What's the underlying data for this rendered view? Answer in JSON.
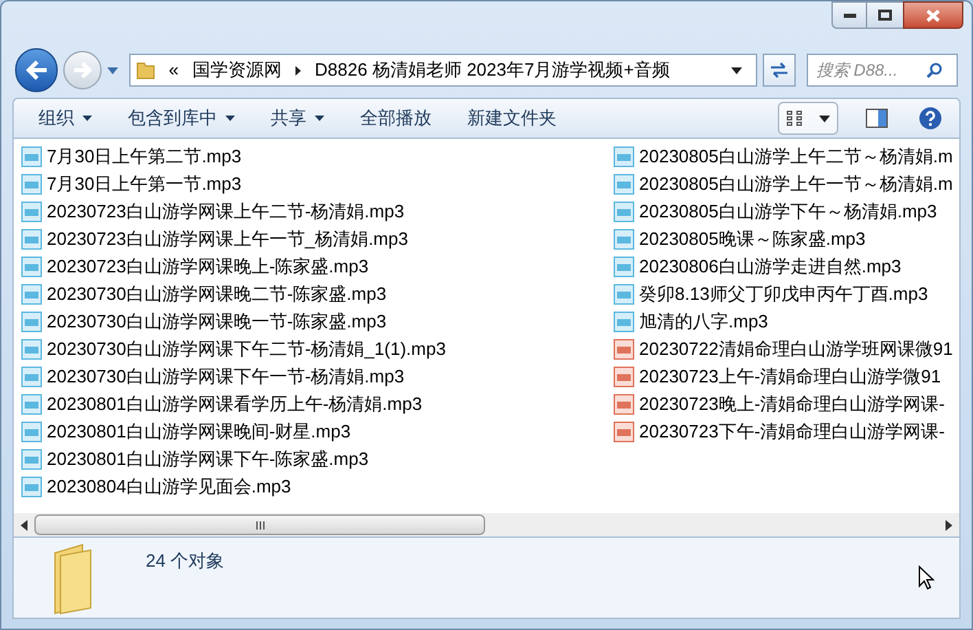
{
  "address_bar": {
    "overflow": "«",
    "path": [
      {
        "label": "国学资源网"
      },
      {
        "label": "D8826 杨清娟老师 2023年7月游学视频+音频"
      }
    ]
  },
  "search": {
    "placeholder": "搜索 D88..."
  },
  "toolbar": [
    {
      "label": "组织",
      "dropdown": true
    },
    {
      "label": "包含到库中",
      "dropdown": true
    },
    {
      "label": "共享",
      "dropdown": true
    },
    {
      "label": "全部播放",
      "dropdown": false
    },
    {
      "label": "新建文件夹",
      "dropdown": false
    }
  ],
  "file_columns": [
    [
      {
        "name": "7月30日上午第二节.mp3",
        "kind": "mp3"
      },
      {
        "name": "7月30日上午第一节.mp3",
        "kind": "mp3"
      },
      {
        "name": "20230723白山游学网课上午二节-杨清娟.mp3",
        "kind": "mp3"
      },
      {
        "name": "20230723白山游学网课上午一节_杨清娟.mp3",
        "kind": "mp3"
      },
      {
        "name": "20230723白山游学网课晚上-陈家盛.mp3",
        "kind": "mp3"
      },
      {
        "name": "20230730白山游学网课晚二节-陈家盛.mp3",
        "kind": "mp3"
      },
      {
        "name": "20230730白山游学网课晚一节-陈家盛.mp3",
        "kind": "mp3"
      },
      {
        "name": "20230730白山游学网课下午二节-杨清娟_1(1).mp3",
        "kind": "mp3"
      },
      {
        "name": "20230730白山游学网课下午一节-杨清娟.mp3",
        "kind": "mp3"
      },
      {
        "name": "20230801白山游学网课看学历上午-杨清娟.mp3",
        "kind": "mp3"
      },
      {
        "name": "20230801白山游学网课晚间-财星.mp3",
        "kind": "mp3"
      },
      {
        "name": "20230801白山游学网课下午-陈家盛.mp3",
        "kind": "mp3"
      },
      {
        "name": "20230804白山游学见面会.mp3",
        "kind": "mp3"
      }
    ],
    [
      {
        "name": "20230805白山游学上午二节～杨清娟.m",
        "kind": "mp3"
      },
      {
        "name": "20230805白山游学上午一节～杨清娟.m",
        "kind": "mp3"
      },
      {
        "name": "20230805白山游学下午～杨清娟.mp3",
        "kind": "mp3"
      },
      {
        "name": "20230805晚课～陈家盛.mp3",
        "kind": "mp3"
      },
      {
        "name": "20230806白山游学走进自然.mp3",
        "kind": "mp3"
      },
      {
        "name": "癸卯8.13师父丁卯戊申丙午丁酉.mp3",
        "kind": "mp3"
      },
      {
        "name": "旭清的八字.mp3",
        "kind": "mp3"
      },
      {
        "name": "20230722清娟命理白山游学班网课微91",
        "kind": "mp4"
      },
      {
        "name": "20230723上午-清娟命理白山游学微91",
        "kind": "mp4"
      },
      {
        "name": "20230723晚上-清娟命理白山游学网课-",
        "kind": "mp4"
      },
      {
        "name": "20230723下午-清娟命理白山游学网课-",
        "kind": "mp4"
      }
    ]
  ],
  "status": {
    "count": "24 个对象"
  }
}
